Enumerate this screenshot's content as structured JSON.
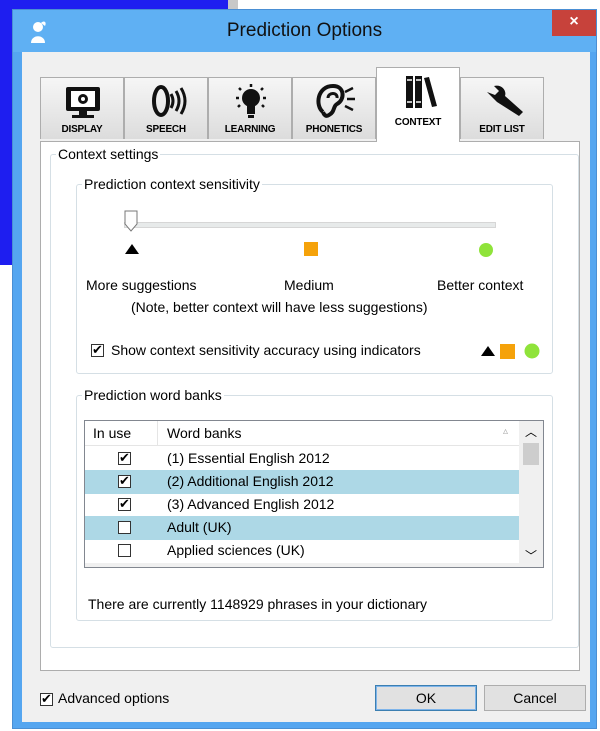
{
  "window": {
    "title": "Prediction Options",
    "close_label": "×"
  },
  "tabs": [
    {
      "label": "DISPLAY",
      "icon": "monitor-icon"
    },
    {
      "label": "SPEECH",
      "icon": "speaker-icon"
    },
    {
      "label": "LEARNING",
      "icon": "lightbulb-icon"
    },
    {
      "label": "PHONETICS",
      "icon": "ear-icon"
    },
    {
      "label": "CONTEXT",
      "icon": "books-icon",
      "active": true
    },
    {
      "label": "EDIT LIST",
      "icon": "wrench-icon"
    }
  ],
  "context": {
    "group_title": "Context settings",
    "sensitivity": {
      "title": "Prediction context sensitivity",
      "slider_value": 0,
      "low_label": "More suggestions",
      "mid_label": "Medium",
      "high_label": "Better context",
      "note": "(Note, better context will have less suggestions)",
      "indicators_label": "Show context sensitivity accuracy using indicators",
      "indicators_checked": true
    },
    "word_banks": {
      "title": "Prediction word banks",
      "col_in_use": "In use",
      "col_word_banks": "Word banks",
      "rows": [
        {
          "name": "(1) Essential English 2012",
          "in_use": true,
          "selected": false
        },
        {
          "name": "(2) Additional English 2012",
          "in_use": true,
          "selected": true
        },
        {
          "name": "(3) Advanced English 2012",
          "in_use": true,
          "selected": false
        },
        {
          "name": "Adult (UK)",
          "in_use": false,
          "selected": true
        },
        {
          "name": "Applied sciences (UK)",
          "in_use": false,
          "selected": false
        }
      ],
      "status": "There are currently 1148929 phrases in your dictionary"
    }
  },
  "footer": {
    "advanced_label": "Advanced options",
    "advanced_checked": true,
    "ok_label": "OK",
    "cancel_label": "Cancel"
  },
  "colors": {
    "title_bar": "#5fb0f3",
    "close": "#c7423b",
    "indicator_triangle": "#000000",
    "indicator_square": "#f5a20a",
    "indicator_circle": "#8fe33a",
    "selected_row": "#add8e6"
  }
}
